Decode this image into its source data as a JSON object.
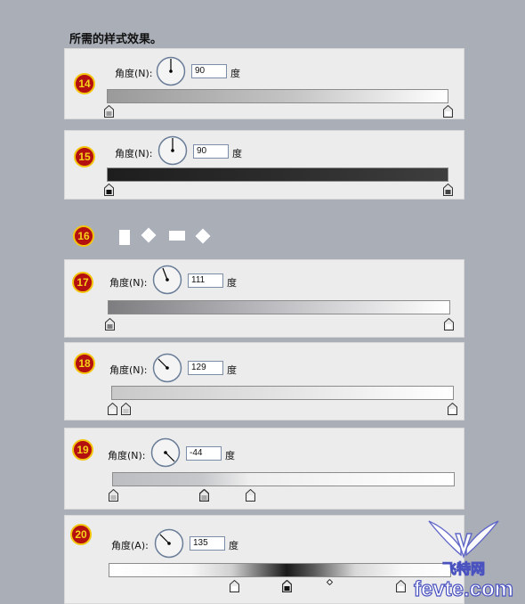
{
  "heading": "所需的样式效果。",
  "angle_label": "角度(N):",
  "angle_label_a": "角度(A):",
  "unit": "度",
  "panels": [
    {
      "number": "14",
      "angle": "90"
    },
    {
      "number": "15",
      "angle": "90"
    },
    {
      "number": "17",
      "angle": "111"
    },
    {
      "number": "18",
      "angle": "129"
    },
    {
      "number": "19",
      "angle": "-44"
    },
    {
      "number": "20",
      "angle": "135"
    }
  ],
  "step16": {
    "number": "16"
  },
  "watermark": {
    "brand": "飞特网",
    "site": "fevte.com"
  },
  "colors": {
    "badge_fill": "#b51010",
    "badge_ring": "#f3c60e",
    "background": "#a9aeb7",
    "panel": "#ececec"
  }
}
